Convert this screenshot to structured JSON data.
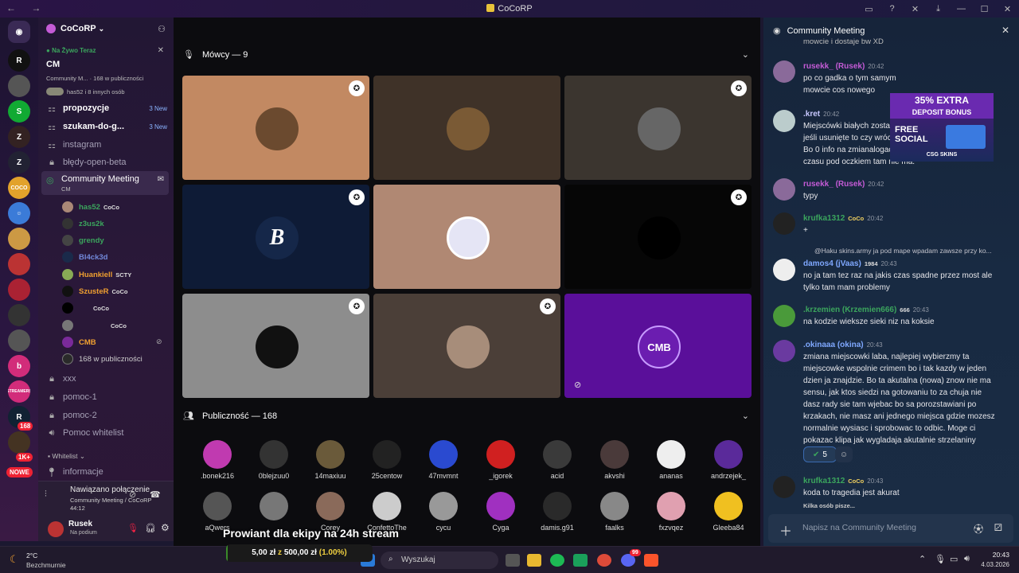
{
  "titlebar": {
    "title": "CoCoRP",
    "nav": "← →"
  },
  "server_badges": {
    "b1": "168",
    "b2": "1K+",
    "nowe": "NOWE"
  },
  "server_text": {
    "coco": "COCO",
    "streamers": "STREAMERS"
  },
  "sidebar": {
    "server_name": "CoCoRP",
    "live_label": "Na Żywo Teraz",
    "live_title": "CM",
    "live_sub": "Community M...  ·  168 w publiczności",
    "live_people": "has52 i 8 innych osób",
    "channels": [
      {
        "name": "propozycje",
        "badge": "3 New"
      },
      {
        "name": "szukam-do-g...",
        "badge": "3 New"
      },
      {
        "name": "instagram"
      },
      {
        "name": "błędy-open-beta"
      },
      {
        "name": "Community Meeting",
        "sub": "CM"
      }
    ],
    "members": [
      {
        "name": "has52",
        "tag": "CoCo",
        "color": "#3ba55d"
      },
      {
        "name": "z3us2k",
        "tag": "",
        "color": "#3ba55d"
      },
      {
        "name": "grendy",
        "tag": "",
        "color": "#3ba55d"
      },
      {
        "name": "Bl4ck3d",
        "tag": "",
        "color": "#7289da"
      },
      {
        "name": "Huankiell",
        "tag": "SCTY",
        "color": "#f0a030"
      },
      {
        "name": "SzusteR",
        "tag": "CoCo",
        "color": "#f0a030"
      },
      {
        "name": "",
        "tag": "CoCo",
        "color": "#f0a030"
      },
      {
        "name": "",
        "tag": "CoCo",
        "color": "#f0a030"
      },
      {
        "name": "CMB",
        "tag": "",
        "color": "#f0a030"
      }
    ],
    "audience": "168 w publiczności",
    "channels2": [
      "xxx",
      "pomoc-1",
      "pomoc-2",
      "Pomoc whitelist"
    ],
    "category": "Whitelist",
    "info": "informacje",
    "voice_status": "Nawiązano połączenie",
    "voice_channel": "Community Meeting / CoCoRP",
    "voice_time": "44:12",
    "user": "Rusek",
    "user_status": "Na podium"
  },
  "main": {
    "speakers_label": "Mówcy — 9",
    "audience_label": "Publiczność — 168",
    "audience": [
      ".bonek216",
      "0blejzuu0",
      "14maxiuu",
      "25centow",
      "47mvmnt",
      "_igorek",
      "acid",
      "akvshi",
      "ananas",
      "andrzejek_",
      "aQwers",
      "",
      "Corey",
      "ConfettoThe",
      "cycu",
      "Cyga",
      "damis.g91",
      "faalks",
      "fxzvqez",
      "Gleeba84"
    ],
    "tile_letters": {
      "b": "B",
      "cmb": "CMB"
    }
  },
  "stream_overlay": {
    "title": "Prowiant dla ekipy na 24h stream",
    "amount": "5,00 zł",
    "z": "z",
    "goal": "500,00 zł",
    "pct": "(1.00%)",
    "progress": 0.01
  },
  "chat": {
    "title": "Community Meeting",
    "top_fragment": "mowcie i dostaje bw XD",
    "messages": [
      {
        "user": "rusekk_",
        "nick": "(Rusek)",
        "time": "20:42",
        "lines": [
          "po co gadka o tym samym",
          "mowcie cos nowego"
        ],
        "color": "#c45bd6"
      },
      {
        "user": ".kret",
        "nick": "",
        "time": "20:42",
        "lines": [
          "Miejscówki białych zosta...",
          "jeśli usunięte to czy wróc...",
          "Bo 0 info na zmianalogac...",
          "czasu pod oczkiem tam nie ma."
        ],
        "color": "#c8c8ff"
      },
      {
        "user": "rusekk_",
        "nick": "(Rusek)",
        "time": "20:42",
        "lines": [
          "typy"
        ],
        "color": "#c45bd6"
      },
      {
        "user": "krufka1312",
        "nick": "",
        "time": "20:42",
        "lines": [
          "+"
        ],
        "color": "#3ba55d"
      },
      {
        "user": "damos4",
        "nick": "(jVaas)",
        "time": "20:43",
        "reply": "@Haku skins.army ja pod mape wpadam zawsze przy ko...",
        "lines": [
          "no ja tam tez raz na jakis czas spadne przez most ale",
          "tylko tam mam problemy"
        ],
        "color": "#7fa8ff"
      },
      {
        "user": ".krzemien",
        "nick": "(Krzemien666)",
        "time": "20:43",
        "lines": [
          "na kodzie wieksze sieki niz na koksie"
        ],
        "color": "#3ba55d"
      },
      {
        "user": ".okinaaa",
        "nick": "(okina)",
        "time": "20:43",
        "lines": [
          "zmiana miejscowki laba, najlepiej wybierzmy ta",
          "miejscowke wspolnie crimem bo i tak kazdy w jeden",
          "dzien ja znajdzie. Bo ta akutalna (nowa) znow nie ma",
          "sensu, jak ktos siedzi na gotowaniu to za chuja nie",
          "dasz rady sie tam wjebac bo sa porozstawiani po",
          "krzakach, nie masz ani jednego miejsca gdzie mozesz",
          "normalnie wysiasc i sprobowac to odbic. Moge ci",
          "pokazac klipa jak wygladaja akutalnie strzelaniny"
        ],
        "color": "#7fa8ff"
      },
      {
        "user": "krufka1312",
        "nick": "",
        "time": "20:43",
        "lines": [
          "koda to tragedia jest akurat"
        ],
        "color": "#3ba55d"
      }
    ],
    "reaction_count": "5",
    "typing": "Kilka osób pisze...",
    "input_placeholder": "Napisz na Community Meeting",
    "badges": {
      "coco": "CoCo",
      "b1984": "1984",
      "b666": "666"
    }
  },
  "ad": {
    "line1": "35% EXTRA",
    "line2": "DEPOSIT BONUS",
    "line3": "FREE",
    "line4": "SOCIAL",
    "brand": "CSG SKINS"
  },
  "taskbar": {
    "weather_temp": "2°C",
    "weather_desc": "Bezchmurnie",
    "search": "Wyszukaj",
    "time": "20:43",
    "date": "4.03.2026",
    "discord_badge": "99"
  }
}
